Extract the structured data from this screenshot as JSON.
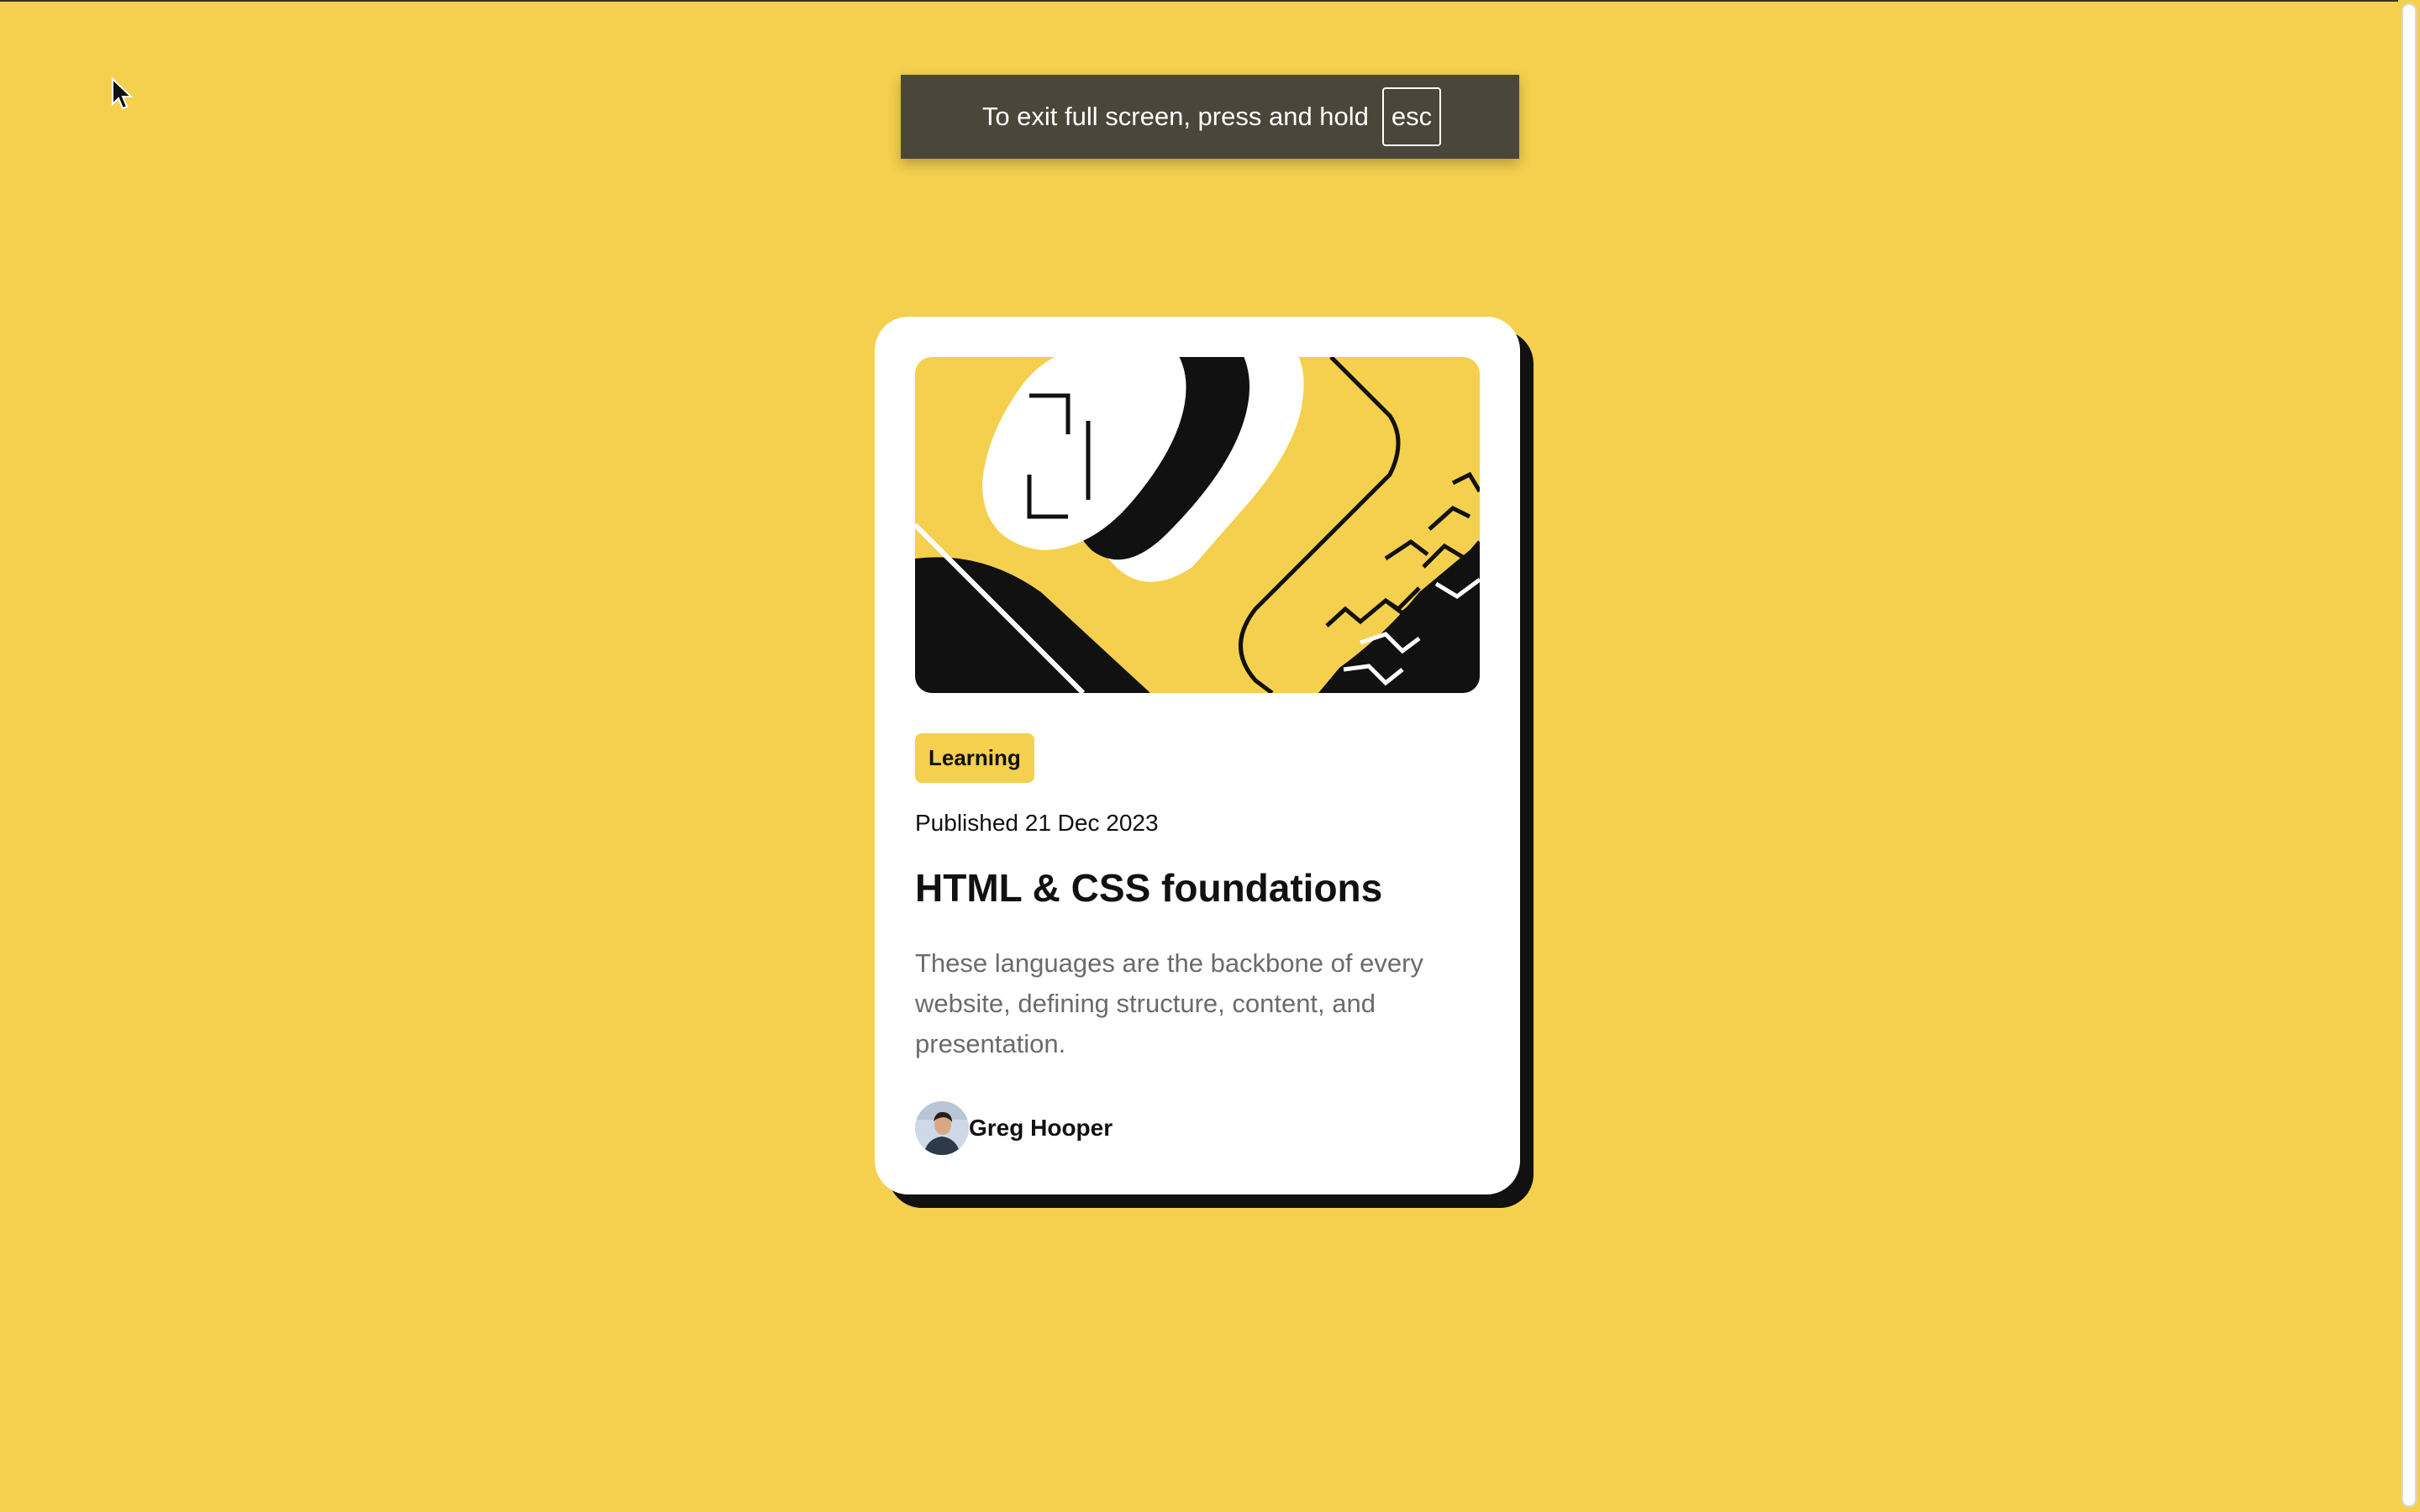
{
  "browser": {
    "fullscreen_notice": "To exit full screen, press and hold",
    "fullscreen_key": "esc"
  },
  "card": {
    "category": "Learning",
    "published": "Published 21 Dec 2023",
    "title": "HTML & CSS foundations",
    "description": "These languages are the backbone of every website, defining structure, content, and presentation.",
    "author_name": "Greg Hooper"
  },
  "colors": {
    "background": "#f4d04e",
    "card": "#ffffff",
    "ink": "#111111",
    "muted_text": "#6b6b6b"
  },
  "icons": {
    "cursor": "mouse-pointer-icon",
    "avatar": "author-avatar"
  }
}
